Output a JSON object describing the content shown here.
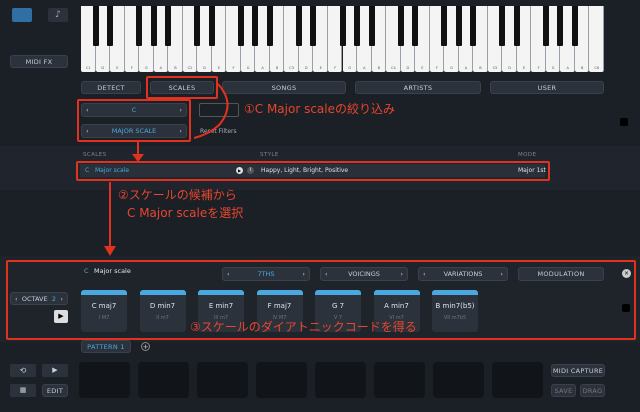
{
  "topbar": {
    "midi_fx_label": "MIDI FX",
    "keyboard_labels": [
      "C1",
      "D",
      "E",
      "F",
      "G",
      "A",
      "B",
      "C2",
      "D",
      "E",
      "F",
      "G",
      "A",
      "B",
      "C3",
      "D",
      "E",
      "F",
      "G",
      "A",
      "B",
      "C4",
      "D",
      "E",
      "F",
      "G",
      "A",
      "B",
      "C5",
      "D",
      "E",
      "F",
      "G",
      "A",
      "B",
      "C6"
    ]
  },
  "tabs": [
    {
      "label": "DETECT"
    },
    {
      "label": "SCALES"
    },
    {
      "label": "SONGS"
    },
    {
      "label": "ARTISTS"
    },
    {
      "label": "USER"
    }
  ],
  "filters": {
    "key_value": "C",
    "scale_value": "MAJOR SCALE",
    "reset_label": "Reset Filters"
  },
  "results": {
    "col_scales": "SCALES",
    "col_style": "STYLE",
    "col_mode": "MODE",
    "row": {
      "key": "C",
      "name": "Major scale",
      "style": "Happy, Light, Bright, Positive",
      "mode": "Major 1st"
    }
  },
  "chords_panel": {
    "key": "C",
    "scale_name": "Major scale",
    "sevenths": "7THS",
    "voicings": "VOICINGS",
    "variations": "VARIATIONS",
    "modulation": "MODULATION",
    "octave_label": "OCTAVE",
    "octave_value": "2",
    "chords": [
      {
        "name": "C maj7",
        "deg": "I M7"
      },
      {
        "name": "D min7",
        "deg": "II m7"
      },
      {
        "name": "E min7",
        "deg": "III m7"
      },
      {
        "name": "F maj7",
        "deg": "IV M7"
      },
      {
        "name": "G 7",
        "deg": "V 7"
      },
      {
        "name": "A min7",
        "deg": "VI m7"
      },
      {
        "name": "B min7(b5)",
        "deg": "VII m7b5"
      }
    ]
  },
  "pattern": {
    "label": "PATTERN 1",
    "add": "+"
  },
  "bottom": {
    "edit": "EDIT",
    "midi_capture": "MIDI CAPTURE",
    "save": "SAVE",
    "drag": "DRAG"
  },
  "annotations": {
    "a1": "①C Major scaleの絞り込み",
    "a2_line1": "②スケールの候補から",
    "a2_line2": "C Major scaleを選択",
    "a3": "③スケールのダイアトニックコードを得る"
  },
  "colors": {
    "accent": "#4aa8e0",
    "annotation": "#e0321e"
  }
}
